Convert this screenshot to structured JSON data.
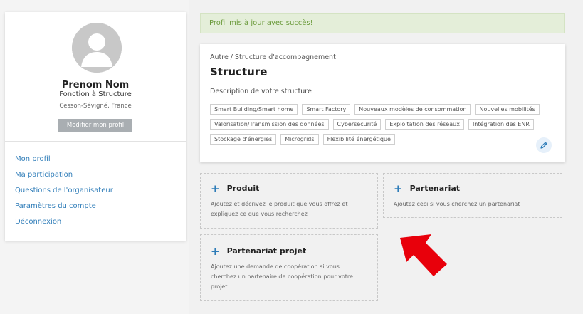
{
  "profile": {
    "name": "Prenom Nom",
    "role": "Fonction à Structure",
    "location": "Cesson-Sévigné, France",
    "edit_button": "Modifier mon profil",
    "menu": [
      {
        "label": "Mon profil"
      },
      {
        "label": "Ma participation"
      },
      {
        "label": "Questions de l'organisateur"
      },
      {
        "label": "Paramètres du compte"
      },
      {
        "label": "Déconnexion"
      }
    ]
  },
  "banner": {
    "message": "Profil mis à jour avec succès!"
  },
  "structure": {
    "breadcrumb": "Autre / Structure d'accompagnement",
    "title": "Structure",
    "description": "Description de votre structure",
    "tags": [
      "Smart Building/Smart home",
      "Smart Factory",
      "Nouveaux modèles de consommation",
      "Nouvelles mobilités",
      "Valorisation/Transmission des données",
      "Cybersécurité",
      "Exploitation des réseaux",
      "Intégration des ENR",
      "Stockage d'énergies",
      "Microgrids",
      "Flexibilité énergétique"
    ]
  },
  "actions": {
    "produit": {
      "title": "Produit",
      "line1": "Ajoutez et décrivez le produit que vous offrez et",
      "line2": "expliquez ce que vous recherchez"
    },
    "partenariat": {
      "title": "Partenariat",
      "line1": "Ajoutez ceci si vous cherchez un partenariat"
    },
    "partenariat_projet": {
      "title": "Partenariat projet",
      "line1": "Ajoutez une demande de coopération si vous",
      "line2": "cherchez un partenaire de coopération pour votre",
      "line3": "projet"
    }
  },
  "colors": {
    "accent": "#2e7cb8",
    "success_text": "#6a9a3a",
    "success_bg": "#e4eed9",
    "arrow": "#e8000b"
  },
  "icons": [
    "user-avatar-icon",
    "plus-icon",
    "pencil-icon",
    "red-arrow-icon"
  ]
}
